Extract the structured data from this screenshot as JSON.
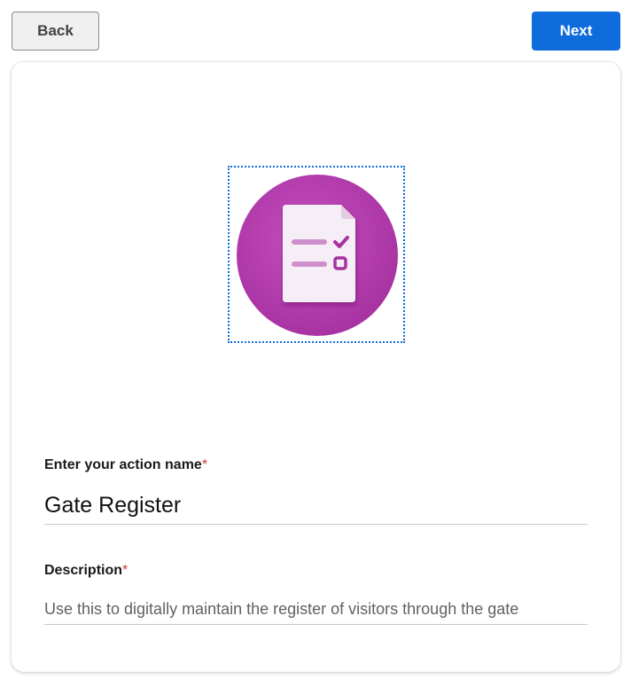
{
  "toolbar": {
    "back_label": "Back",
    "next_label": "Next"
  },
  "colors": {
    "primary": "#0f6cdc",
    "icon_circle": "#b63fb2",
    "required": "#d13438"
  },
  "icon": {
    "name": "forms-checklist-document-icon"
  },
  "form": {
    "name_label": "Enter your action name",
    "name_required": "*",
    "name_value": "Gate Register",
    "description_label": "Description",
    "description_required": "*",
    "description_value": "Use this to digitally maintain the register of visitors through the gate"
  }
}
